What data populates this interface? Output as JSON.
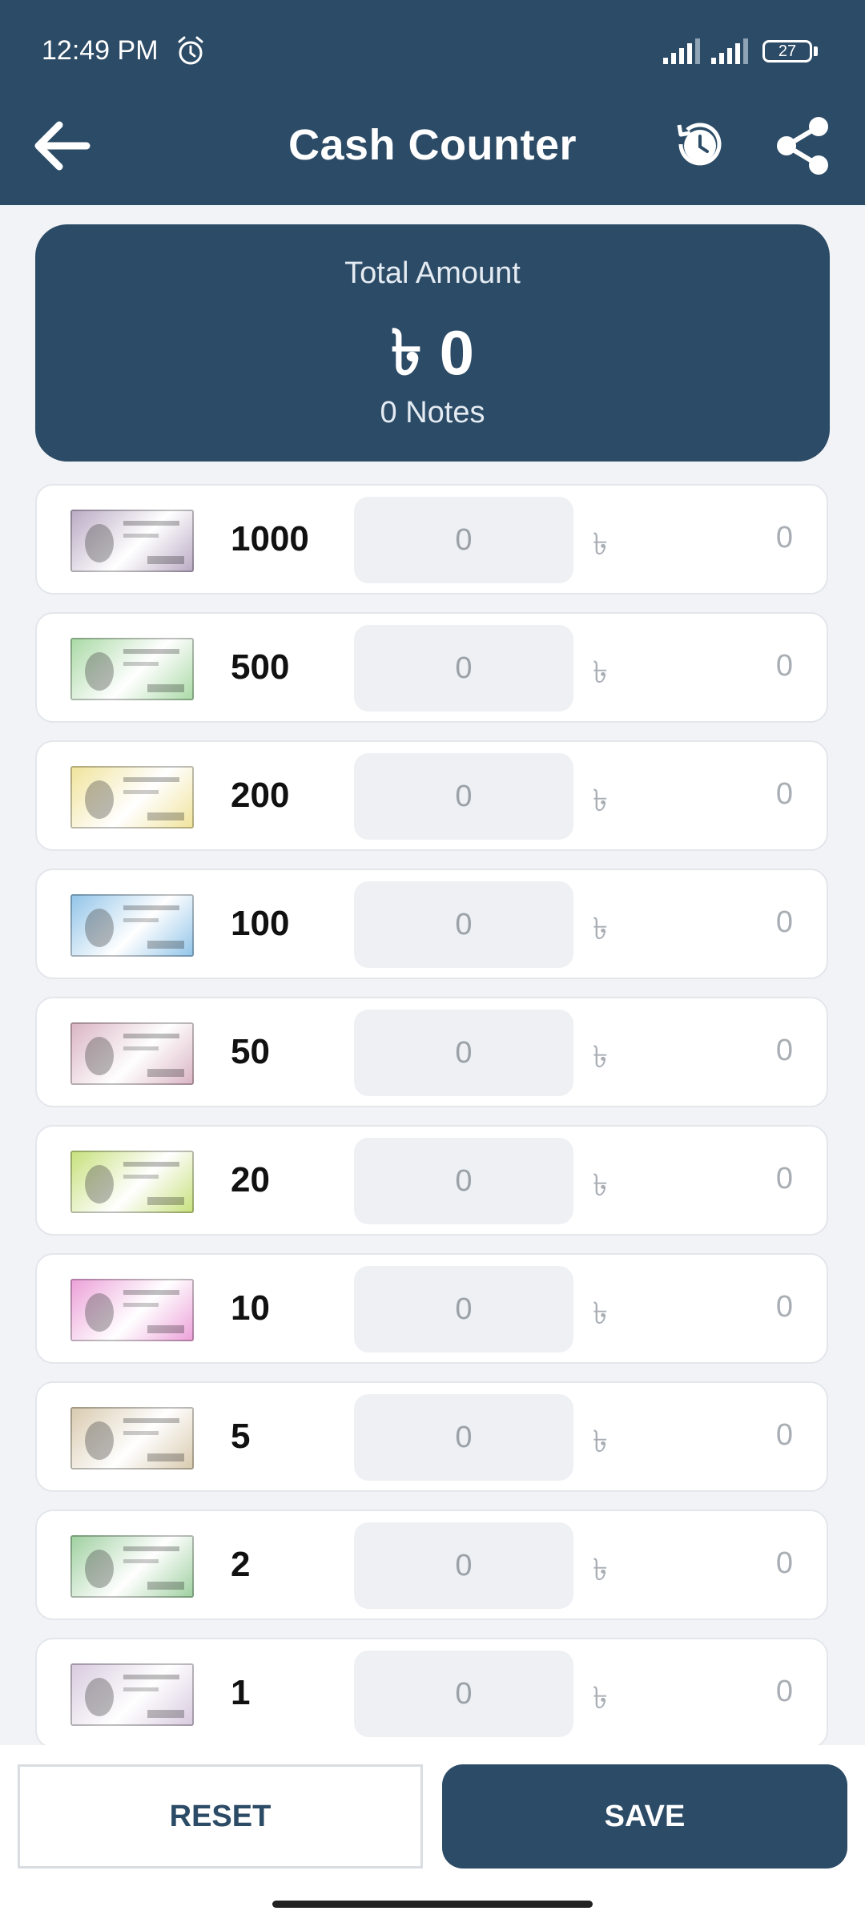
{
  "status_bar": {
    "time": "12:49 PM",
    "battery": "27"
  },
  "header": {
    "title": "Cash Counter"
  },
  "summary": {
    "label": "Total Amount",
    "amount": "৳ 0",
    "notes": "0 Notes"
  },
  "currency_symbol": "৳",
  "denominations": [
    {
      "value": "1000",
      "count": "0",
      "total": "0",
      "color": "#b9a9c3"
    },
    {
      "value": "500",
      "count": "0",
      "total": "0",
      "color": "#a8d9a4"
    },
    {
      "value": "200",
      "count": "0",
      "total": "0",
      "color": "#f0e39a"
    },
    {
      "value": "100",
      "count": "0",
      "total": "0",
      "color": "#8fc3e8"
    },
    {
      "value": "50",
      "count": "0",
      "total": "0",
      "color": "#d9b3c2"
    },
    {
      "value": "20",
      "count": "0",
      "total": "0",
      "color": "#c6e07a"
    },
    {
      "value": "10",
      "count": "0",
      "total": "0",
      "color": "#ec9fd8"
    },
    {
      "value": "5",
      "count": "0",
      "total": "0",
      "color": "#d8c9ad"
    },
    {
      "value": "2",
      "count": "0",
      "total": "0",
      "color": "#9dcf9e"
    },
    {
      "value": "1",
      "count": "0",
      "total": "0",
      "color": "#d7c9de"
    }
  ],
  "actions": {
    "reset": "RESET",
    "save": "SAVE"
  },
  "colors": {
    "primary": "#2c4b66",
    "background": "#f1f3f6"
  }
}
